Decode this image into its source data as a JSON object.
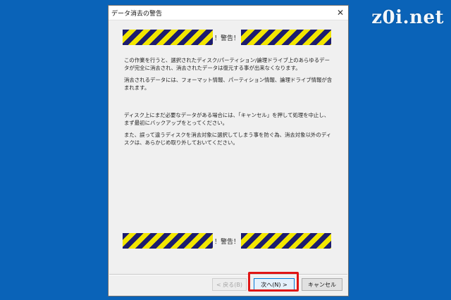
{
  "watermark": "z0i.net",
  "dialog": {
    "title": "データ消去の警告",
    "close_glyph": "✕"
  },
  "warning": {
    "label": "！警告！"
  },
  "content": {
    "paragraphs": [
      "この作業を行うと、選択されたディスク/パーティション/論理ドライブ上のあらゆるデータが完全に消去され、消去されたデータは復元する事が出来なくなります。",
      "消去されるデータには、フォーマット情報、パーティション情報、論理ドライブ情報が含まれます。",
      "ディスク上にまだ必要なデータがある場合には、「キャンセル」を押して処理を中止し、まず最初にバックアップをとってください。",
      "また、誤って違うディスクを消去対象に選択してしまう事を防ぐ為、消去対象以外のディスクは、あらかじめ取り外しておいてください。"
    ]
  },
  "buttons": {
    "back": "< 戻る(B)",
    "next": "次へ(N) >",
    "cancel": "キャンセル"
  },
  "colors": {
    "desktop": "#0a63b8",
    "stripe_dark": "#1c1c6e",
    "stripe_yellow": "#f2e600",
    "highlight": "#e01515"
  }
}
